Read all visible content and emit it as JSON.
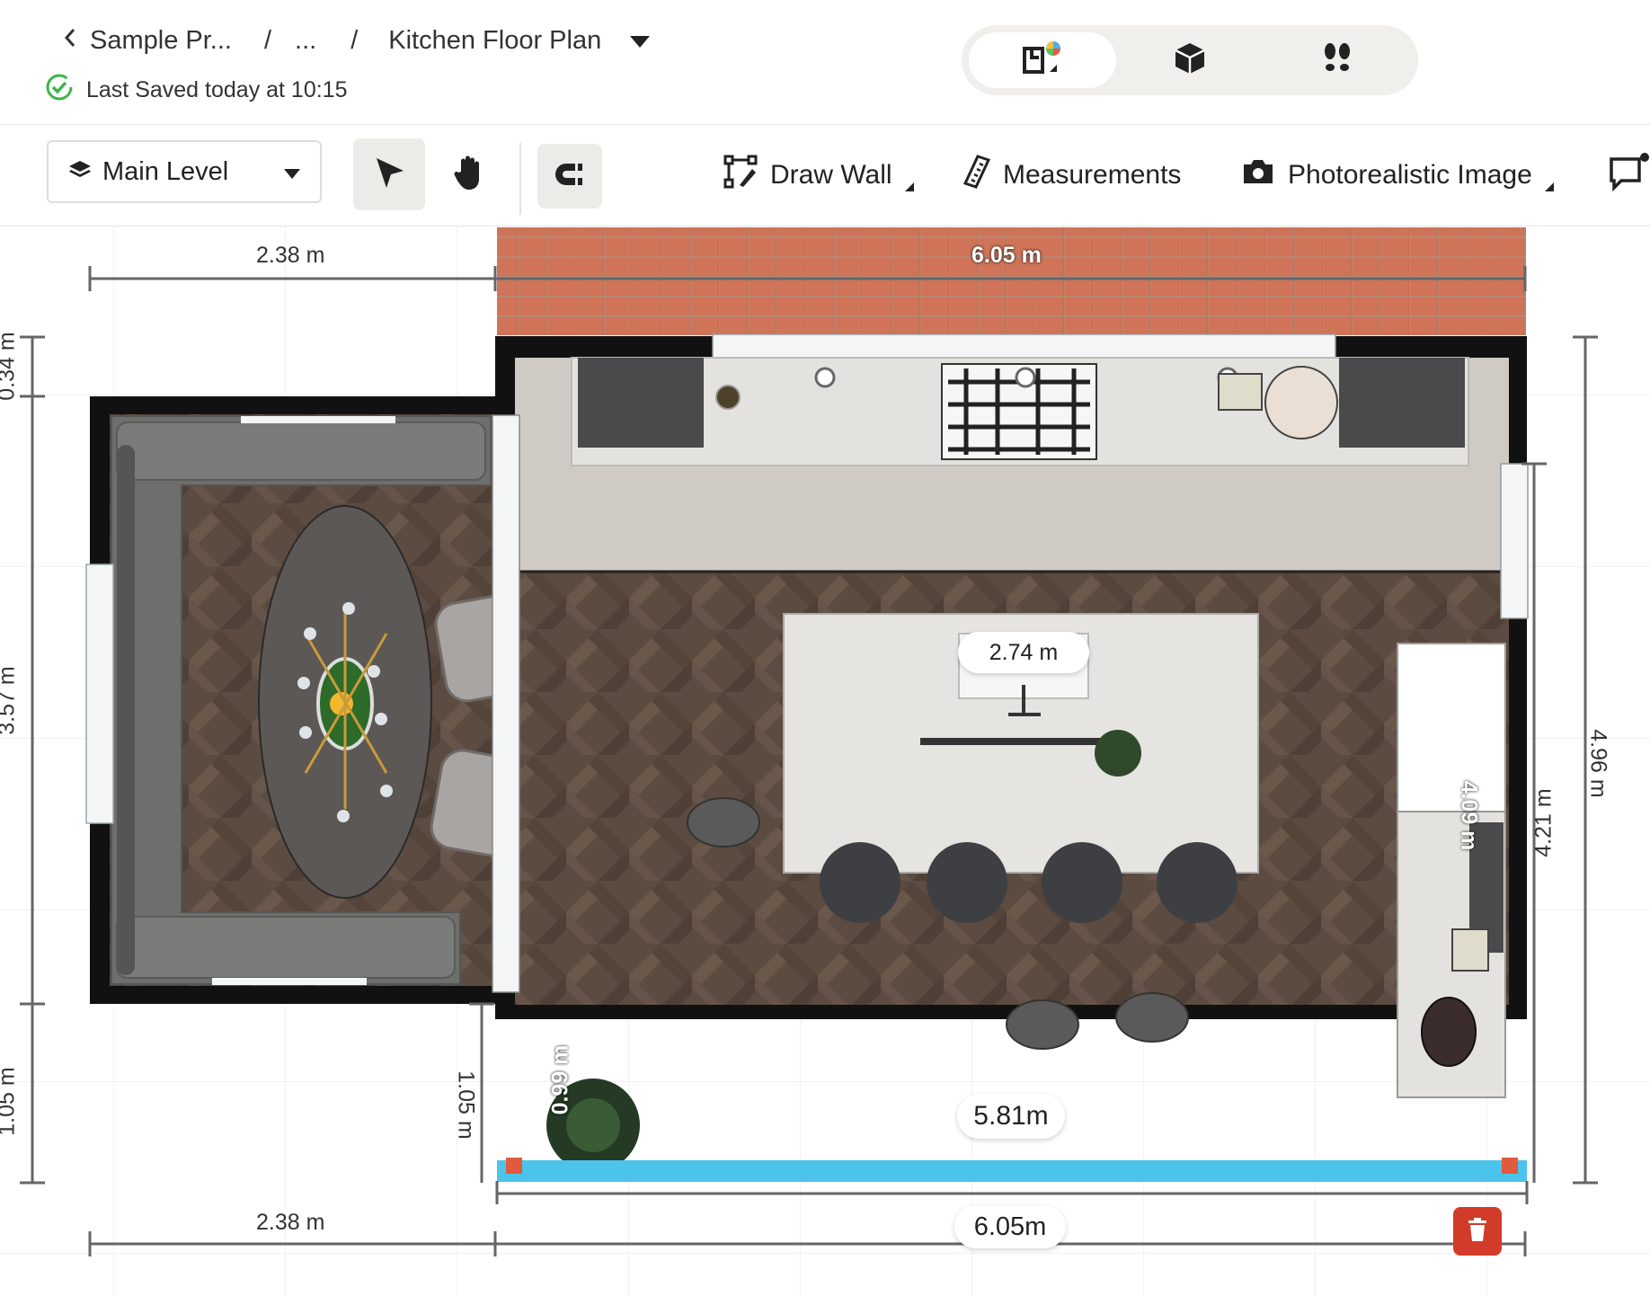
{
  "header": {
    "back_label": "Sample Pr...",
    "sep": "/",
    "ellipsis": "...",
    "project_title": "Kitchen Floor Plan",
    "saved_text": "Last Saved today at 10:15",
    "view_modes": [
      "2d-plan",
      "3d-view",
      "walkthrough"
    ],
    "active_view": "2d-plan"
  },
  "toolbar": {
    "level_label": "Main Level",
    "draw_wall_label": "Draw Wall",
    "measurements_label": "Measurements",
    "photo_label": "Photorealistic Image"
  },
  "dimensions": {
    "top_left": "2.38 m",
    "top_main": "6.05 m",
    "left_top": "0.34 m",
    "left_mid": "3.57 m",
    "left_bottom": "1.05 m",
    "inner_left": "1.05 m",
    "door": "0.99 m",
    "island": "2.74 m",
    "right_inner": "4.09 m",
    "right_mid": "4.21 m",
    "right_outer": "4.96 m",
    "selected_wall": "5.81m",
    "bottom_main": "6.05m",
    "bottom_left": "2.38 m"
  },
  "colors": {
    "brick": "#c8694e",
    "floor": "#5a4a3f",
    "selected_wall": "#4cc3ea",
    "delete": "#d23b2a",
    "saved_ok": "#3bb54a"
  }
}
